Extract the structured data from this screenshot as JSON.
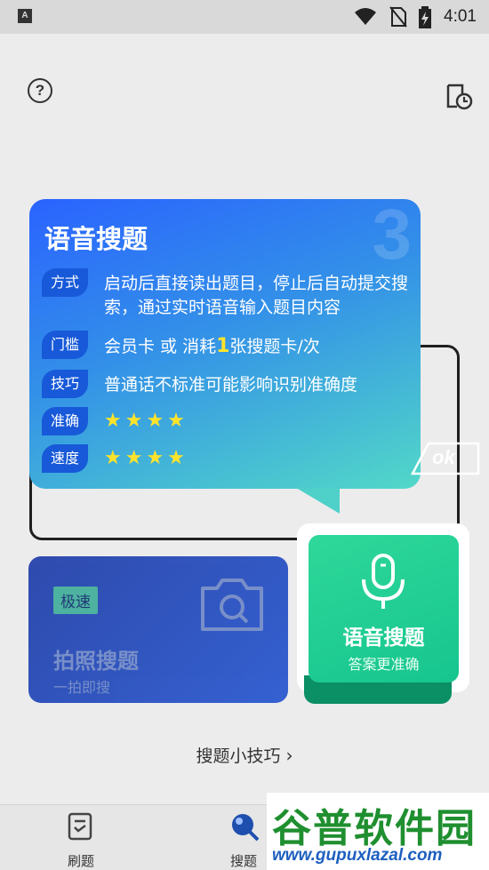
{
  "status_bar": {
    "app_icon_letter": "A",
    "time": "4:01",
    "icons": [
      "wifi-icon",
      "no-sim-icon",
      "battery-charging-icon"
    ]
  },
  "header": {
    "help_icon": "help-circle-icon",
    "history_icon": "history-clock-icon"
  },
  "photo_search": {
    "badge": "极速",
    "title": "拍照搜题",
    "subtitle": "一拍即搜",
    "icon": "camera-search-icon"
  },
  "voice_search": {
    "title": "语音搜题",
    "subtitle": "答案更准确",
    "icon": "microphone-icon"
  },
  "tips_link": {
    "label": "搜题小技巧"
  },
  "popover": {
    "step_number": "3",
    "title": "语音搜题",
    "rows": [
      {
        "tag": "方式",
        "text": "启动后直接读出题目，停止后自动提交搜索，通过实时语音输入题目内容"
      },
      {
        "tag": "门槛",
        "text_before": "会员卡 或 消耗",
        "highlight": "1",
        "text_after": "张搜题卡/次"
      },
      {
        "tag": "技巧",
        "text": "普通话不标准可能影响识别准确度"
      },
      {
        "tag": "准确",
        "stars": "★★★★"
      },
      {
        "tag": "速度",
        "stars": "★★★★"
      }
    ],
    "ok_label": "ok"
  },
  "bottom_nav": {
    "items": [
      {
        "label": "刷题",
        "icon": "practice-icon"
      },
      {
        "label": "搜题",
        "icon": "search-question-icon"
      }
    ]
  },
  "watermark": {
    "title": "谷普软件园",
    "url": "www.gupuxlazal.com"
  },
  "colors": {
    "popover_start": "#2a63ff",
    "popover_end": "#52d8c8",
    "voice_card": "#1fcf93",
    "photo_card": "#2555cf",
    "star": "#ffe32b"
  }
}
